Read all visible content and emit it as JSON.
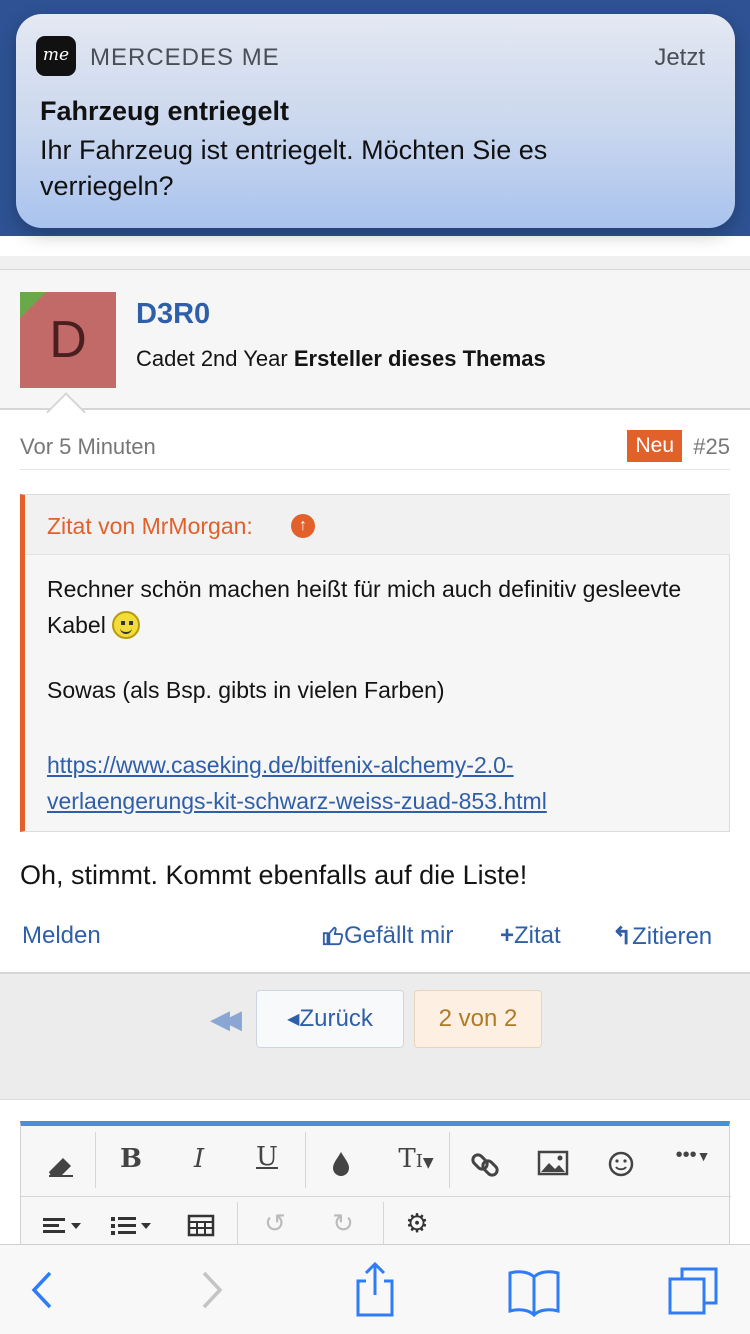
{
  "notification": {
    "app_name": "MERCEDES ME",
    "app_icon_text": "me",
    "time": "Jetzt",
    "title": "Fahrzeug entriegelt",
    "body": "Ihr Fahrzeug ist entriegelt. Möchten Sie es verriegeln?"
  },
  "post": {
    "avatar_letter": "D",
    "username": "D3R0",
    "user_rank": "Cadet 2nd Year",
    "user_badge": "Ersteller dieses Themas",
    "time": "Vor 5 Minuten",
    "new_label": "Neu",
    "post_number": "#25",
    "quote": {
      "author": "Zitat von MrMorgan:",
      "line1": "Rechner schön machen heißt für mich auch definitiv gesleevte Kabel",
      "line2": "Sowas (als Bsp. gibts in vielen Farben)",
      "link": "https://www.caseking.de/bitfenix-alchemy-2.0-verlaengerungs-kit-schwarz-weiss-zuad-853.html"
    },
    "text": "Oh, stimmt. Kommt ebenfalls auf die Liste!",
    "actions": {
      "report": "Melden",
      "like": "Gefällt mir",
      "quote_add": "Zitat",
      "reply_quote": "Zitieren"
    }
  },
  "pagination": {
    "back": "Zurück",
    "current": "2 von 2"
  },
  "editor": {
    "toolbar_row1": [
      "eraser-icon",
      "bold-icon",
      "italic-icon",
      "underline-icon",
      "color-drop-icon",
      "text-size-icon",
      "link-icon",
      "image-icon",
      "smiley-icon",
      "more-icon"
    ],
    "toolbar_row2": [
      "align-icon",
      "list-icon",
      "table-icon",
      "undo-icon",
      "redo-icon",
      "settings-icon"
    ],
    "accent": "#4a90d9"
  },
  "colors": {
    "header_blue": "#2e5294",
    "link_blue": "#2f5fa8",
    "accent_orange": "#e2602a"
  }
}
